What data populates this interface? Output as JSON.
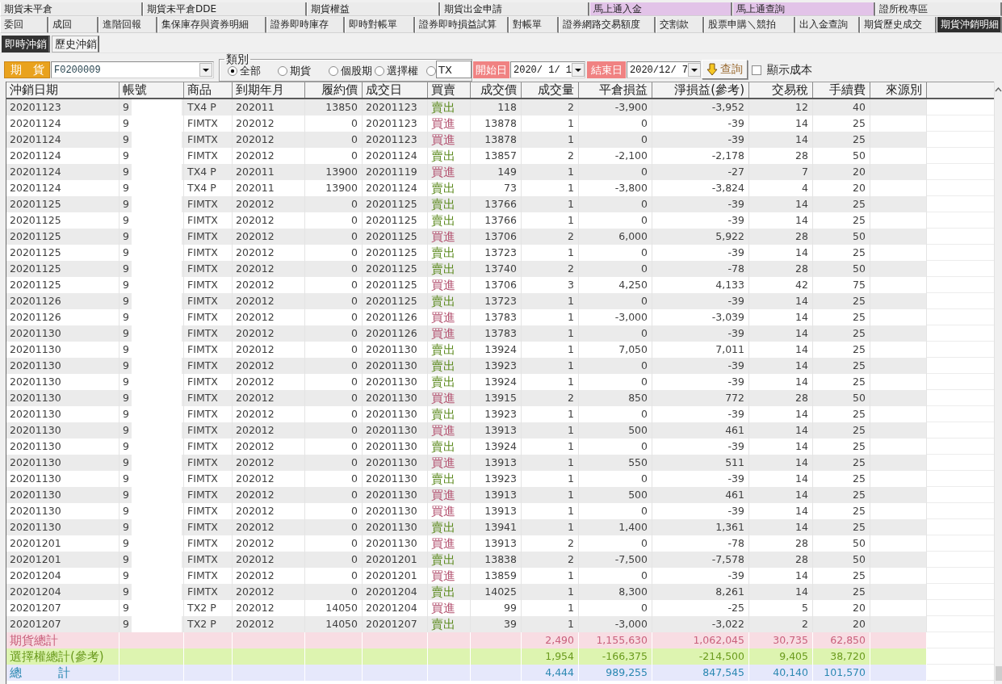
{
  "top_tabs": [
    {
      "label": "期貨未平倉",
      "selected": false
    },
    {
      "label": "期貨未平倉DDE",
      "selected": false
    },
    {
      "label": "期貨權益",
      "selected": false
    },
    {
      "label": "期貨出金申請",
      "selected": false
    },
    {
      "label": "馬上通入金",
      "selected": false,
      "color": "#e2c3e8"
    },
    {
      "label": "馬上通查詢",
      "selected": false,
      "color": "#e2c3e8"
    },
    {
      "label": "證所稅專區",
      "selected": false
    }
  ],
  "function_tabs": [
    {
      "label": "委回",
      "selected": false
    },
    {
      "label": "成回",
      "selected": false
    },
    {
      "label": "進階回報",
      "selected": false
    },
    {
      "label": "集保庫存與資券明細",
      "selected": false
    },
    {
      "label": "證券即時庫存",
      "selected": false
    },
    {
      "label": "即時對帳單",
      "selected": false
    },
    {
      "label": "證券即時損益試算",
      "selected": false
    },
    {
      "label": "對帳單",
      "selected": false
    },
    {
      "label": "證券網路交易額度",
      "selected": false
    },
    {
      "label": "交割款",
      "selected": false
    },
    {
      "label": "股票申購＼競拍",
      "selected": false
    },
    {
      "label": "出入金查詢",
      "selected": false
    },
    {
      "label": "期貨歷史成交",
      "selected": false
    },
    {
      "label": "期貨沖銷明細",
      "selected": true
    }
  ],
  "sub_tabs": [
    {
      "label": "即時沖銷",
      "selected": true
    },
    {
      "label": "歷史沖銷",
      "selected": false
    }
  ],
  "toolbar": {
    "market_label": "期　貨",
    "account": {
      "value": "F0200009"
    },
    "category": {
      "label": "類別",
      "options": [
        {
          "label": "全部",
          "selected": true
        },
        {
          "label": "期貨",
          "selected": false
        },
        {
          "label": "個股期",
          "selected": false
        },
        {
          "label": "選擇權",
          "selected": false
        }
      ],
      "custom": {
        "selected": false,
        "value": "TX"
      }
    },
    "start_date": {
      "label": "開始日",
      "value": "2020/ 1/ 1"
    },
    "end_date": {
      "label": "結束日",
      "value": "2020/12/ 7"
    },
    "query_button": "查詢",
    "show_cost": {
      "label": "顯示成本",
      "checked": false
    }
  },
  "table": {
    "columns": [
      "沖銷日期",
      "帳號",
      "商品",
      "到期年月",
      "履約價",
      "成交日",
      "買賣",
      "成交價",
      "成交量",
      "平倉損益",
      "淨損益(參考)",
      "交易稅",
      "手續費",
      "來源別"
    ],
    "rows": [
      {
        "kind": "sell",
        "cells": [
          "20201123",
          "9",
          "TX4 P",
          "202011",
          "13850",
          "20201123",
          "賣出",
          "118",
          "2",
          "-3,900",
          "-3,952",
          "12",
          "40"
        ]
      },
      {
        "kind": "buy",
        "cells": [
          "20201124",
          "9",
          "FIMTX",
          "202012",
          "0",
          "20201123",
          "買進",
          "13878",
          "1",
          "0",
          "-39",
          "14",
          "25"
        ]
      },
      {
        "kind": "buy",
        "cells": [
          "20201124",
          "9",
          "FIMTX",
          "202012",
          "0",
          "20201123",
          "買進",
          "13878",
          "1",
          "0",
          "-39",
          "14",
          "25"
        ]
      },
      {
        "kind": "sell",
        "cells": [
          "20201124",
          "9",
          "FIMTX",
          "202012",
          "0",
          "20201124",
          "賣出",
          "13857",
          "2",
          "-2,100",
          "-2,178",
          "28",
          "50"
        ]
      },
      {
        "kind": "buy",
        "cells": [
          "20201124",
          "9",
          "TX4 P",
          "202011",
          "13900",
          "20201119",
          "買進",
          "149",
          "1",
          "0",
          "-27",
          "7",
          "20"
        ]
      },
      {
        "kind": "sell",
        "cells": [
          "20201124",
          "9",
          "TX4 P",
          "202011",
          "13900",
          "20201124",
          "賣出",
          "73",
          "1",
          "-3,800",
          "-3,824",
          "4",
          "20"
        ]
      },
      {
        "kind": "sell",
        "cells": [
          "20201125",
          "9",
          "FIMTX",
          "202012",
          "0",
          "20201125",
          "賣出",
          "13766",
          "1",
          "0",
          "-39",
          "14",
          "25"
        ]
      },
      {
        "kind": "sell",
        "cells": [
          "20201125",
          "9",
          "FIMTX",
          "202012",
          "0",
          "20201125",
          "賣出",
          "13766",
          "1",
          "0",
          "-39",
          "14",
          "25"
        ]
      },
      {
        "kind": "buy",
        "cells": [
          "20201125",
          "9",
          "FIMTX",
          "202012",
          "0",
          "20201125",
          "買進",
          "13706",
          "2",
          "6,000",
          "5,922",
          "28",
          "50"
        ]
      },
      {
        "kind": "sell",
        "cells": [
          "20201125",
          "9",
          "FIMTX",
          "202012",
          "0",
          "20201125",
          "賣出",
          "13723",
          "1",
          "0",
          "-39",
          "14",
          "25"
        ]
      },
      {
        "kind": "sell",
        "cells": [
          "20201125",
          "9",
          "FIMTX",
          "202012",
          "0",
          "20201125",
          "賣出",
          "13740",
          "2",
          "0",
          "-78",
          "28",
          "50"
        ]
      },
      {
        "kind": "buy",
        "cells": [
          "20201125",
          "9",
          "FIMTX",
          "202012",
          "0",
          "20201125",
          "買進",
          "13706",
          "3",
          "4,250",
          "4,133",
          "42",
          "75"
        ]
      },
      {
        "kind": "sell",
        "cells": [
          "20201126",
          "9",
          "FIMTX",
          "202012",
          "0",
          "20201125",
          "賣出",
          "13723",
          "1",
          "0",
          "-39",
          "14",
          "25"
        ]
      },
      {
        "kind": "buy",
        "cells": [
          "20201126",
          "9",
          "FIMTX",
          "202012",
          "0",
          "20201126",
          "買進",
          "13783",
          "1",
          "-3,000",
          "-3,039",
          "14",
          "25"
        ]
      },
      {
        "kind": "buy",
        "cells": [
          "20201130",
          "9",
          "FIMTX",
          "202012",
          "0",
          "20201126",
          "買進",
          "13783",
          "1",
          "0",
          "-39",
          "14",
          "25"
        ]
      },
      {
        "kind": "sell",
        "cells": [
          "20201130",
          "9",
          "FIMTX",
          "202012",
          "0",
          "20201130",
          "賣出",
          "13924",
          "1",
          "7,050",
          "7,011",
          "14",
          "25"
        ]
      },
      {
        "kind": "sell",
        "cells": [
          "20201130",
          "9",
          "FIMTX",
          "202012",
          "0",
          "20201130",
          "賣出",
          "13923",
          "1",
          "0",
          "-39",
          "14",
          "25"
        ]
      },
      {
        "kind": "sell",
        "cells": [
          "20201130",
          "9",
          "FIMTX",
          "202012",
          "0",
          "20201130",
          "賣出",
          "13924",
          "1",
          "0",
          "-39",
          "14",
          "25"
        ]
      },
      {
        "kind": "buy",
        "cells": [
          "20201130",
          "9",
          "FIMTX",
          "202012",
          "0",
          "20201130",
          "買進",
          "13915",
          "2",
          "850",
          "772",
          "28",
          "50"
        ]
      },
      {
        "kind": "sell",
        "cells": [
          "20201130",
          "9",
          "FIMTX",
          "202012",
          "0",
          "20201130",
          "賣出",
          "13923",
          "1",
          "0",
          "-39",
          "14",
          "25"
        ]
      },
      {
        "kind": "buy",
        "cells": [
          "20201130",
          "9",
          "FIMTX",
          "202012",
          "0",
          "20201130",
          "買進",
          "13913",
          "1",
          "500",
          "461",
          "14",
          "25"
        ]
      },
      {
        "kind": "sell",
        "cells": [
          "20201130",
          "9",
          "FIMTX",
          "202012",
          "0",
          "20201130",
          "賣出",
          "13924",
          "1",
          "0",
          "-39",
          "14",
          "25"
        ]
      },
      {
        "kind": "buy",
        "cells": [
          "20201130",
          "9",
          "FIMTX",
          "202012",
          "0",
          "20201130",
          "買進",
          "13913",
          "1",
          "550",
          "511",
          "14",
          "25"
        ]
      },
      {
        "kind": "sell",
        "cells": [
          "20201130",
          "9",
          "FIMTX",
          "202012",
          "0",
          "20201130",
          "賣出",
          "13923",
          "1",
          "0",
          "-39",
          "14",
          "25"
        ]
      },
      {
        "kind": "buy",
        "cells": [
          "20201130",
          "9",
          "FIMTX",
          "202012",
          "0",
          "20201130",
          "買進",
          "13913",
          "1",
          "500",
          "461",
          "14",
          "25"
        ]
      },
      {
        "kind": "buy",
        "cells": [
          "20201130",
          "9",
          "FIMTX",
          "202012",
          "0",
          "20201130",
          "買進",
          "13913",
          "1",
          "0",
          "-39",
          "14",
          "25"
        ]
      },
      {
        "kind": "sell",
        "cells": [
          "20201130",
          "9",
          "FIMTX",
          "202012",
          "0",
          "20201130",
          "賣出",
          "13941",
          "1",
          "1,400",
          "1,361",
          "14",
          "25"
        ]
      },
      {
        "kind": "buy",
        "cells": [
          "20201201",
          "9",
          "FIMTX",
          "202012",
          "0",
          "20201130",
          "買進",
          "13913",
          "2",
          "0",
          "-78",
          "28",
          "50"
        ]
      },
      {
        "kind": "sell",
        "cells": [
          "20201201",
          "9",
          "FIMTX",
          "202012",
          "0",
          "20201201",
          "賣出",
          "13838",
          "2",
          "-7,500",
          "-7,578",
          "28",
          "50"
        ]
      },
      {
        "kind": "buy",
        "cells": [
          "20201204",
          "9",
          "FIMTX",
          "202012",
          "0",
          "20201201",
          "買進",
          "13859",
          "1",
          "0",
          "-39",
          "14",
          "25"
        ]
      },
      {
        "kind": "sell",
        "cells": [
          "20201204",
          "9",
          "FIMTX",
          "202012",
          "0",
          "20201204",
          "賣出",
          "14025",
          "1",
          "8,300",
          "8,261",
          "14",
          "25"
        ]
      },
      {
        "kind": "buy",
        "cells": [
          "20201207",
          "9",
          "TX2 P",
          "202012",
          "14050",
          "20201204",
          "買進",
          "99",
          "1",
          "0",
          "-25",
          "5",
          "20"
        ]
      },
      {
        "kind": "sell",
        "cells": [
          "20201207",
          "9",
          "TX2 P",
          "202012",
          "14050",
          "20201207",
          "賣出",
          "39",
          "1",
          "-3,000",
          "-3,022",
          "2",
          "20"
        ]
      }
    ],
    "summary_rows": [
      {
        "kind": "futures",
        "label": "期貨總計",
        "volume": "2,490",
        "close_pnl": "1,155,630",
        "net_pnl": "1,062,045",
        "tax": "30,735",
        "fee": "62,850"
      },
      {
        "kind": "options",
        "label": "選擇權總計(參考)",
        "volume": "1,954",
        "close_pnl": "-166,375",
        "net_pnl": "-214,500",
        "tax": "9,405",
        "fee": "38,720"
      },
      {
        "kind": "total",
        "label": "總　　　計",
        "volume": "4,444",
        "close_pnl": "989,255",
        "net_pnl": "847,545",
        "tax": "40,140",
        "fee": "101,570"
      }
    ]
  }
}
